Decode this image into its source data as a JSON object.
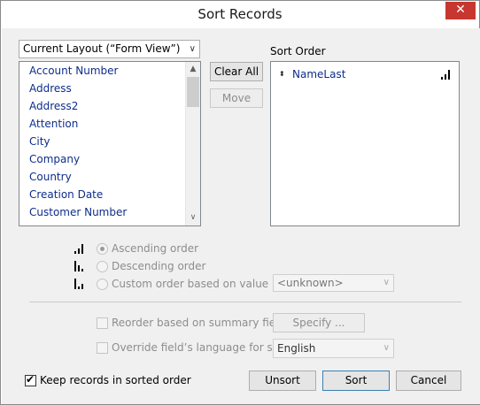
{
  "dialog": {
    "title": "Sort Records",
    "close_glyph": "✕"
  },
  "fields": {
    "layout_select": "Current Layout (“Form View”)",
    "items": [
      "Account Number",
      "Address",
      "Address2",
      "Attention",
      "City",
      "Company",
      "Country",
      "Creation Date",
      "Customer Number"
    ]
  },
  "buttons": {
    "clear_all": "Clear All",
    "move": "Move",
    "specify": "Specify ...",
    "unsort": "Unsort",
    "sort": "Sort",
    "cancel": "Cancel"
  },
  "sort_order": {
    "label": "Sort Order",
    "entries": [
      {
        "field": "NameLast",
        "order_icon": "ascending-bars-icon"
      }
    ]
  },
  "order_options": {
    "ascending": "Ascending order",
    "descending": "Descending order",
    "custom": "Custom order based on value list",
    "value_list": "<unknown>",
    "selected": "ascending"
  },
  "options": {
    "reorder_summary": "Reorder based on summary field",
    "override_language": "Override field’s language for sort",
    "language": "English",
    "keep_sorted": "Keep records in sorted order",
    "keep_sorted_checked": true
  },
  "icons": {
    "scroll_up": "▲",
    "scroll_down": "∨",
    "dropdown": "∨",
    "check": "✔"
  },
  "colors": {
    "field_text": "#0e2d8b",
    "close_button": "#c7372f",
    "default_button_border": "#3c7fb1"
  }
}
